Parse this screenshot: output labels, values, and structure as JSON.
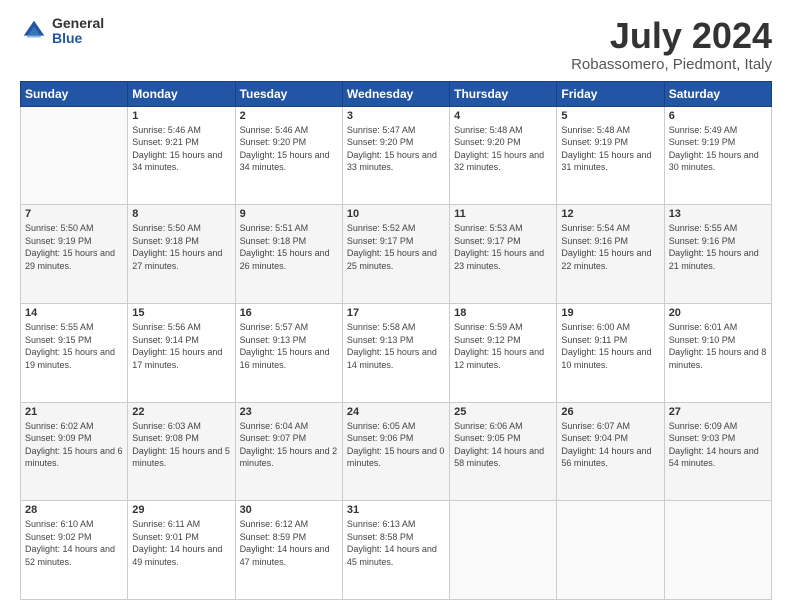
{
  "logo": {
    "general": "General",
    "blue": "Blue"
  },
  "title": "July 2024",
  "subtitle": "Robassomero, Piedmont, Italy",
  "days_of_week": [
    "Sunday",
    "Monday",
    "Tuesday",
    "Wednesday",
    "Thursday",
    "Friday",
    "Saturday"
  ],
  "weeks": [
    [
      {
        "day": "",
        "sunrise": "",
        "sunset": "",
        "daylight": ""
      },
      {
        "day": "1",
        "sunrise": "Sunrise: 5:46 AM",
        "sunset": "Sunset: 9:21 PM",
        "daylight": "Daylight: 15 hours and 34 minutes."
      },
      {
        "day": "2",
        "sunrise": "Sunrise: 5:46 AM",
        "sunset": "Sunset: 9:20 PM",
        "daylight": "Daylight: 15 hours and 34 minutes."
      },
      {
        "day": "3",
        "sunrise": "Sunrise: 5:47 AM",
        "sunset": "Sunset: 9:20 PM",
        "daylight": "Daylight: 15 hours and 33 minutes."
      },
      {
        "day": "4",
        "sunrise": "Sunrise: 5:48 AM",
        "sunset": "Sunset: 9:20 PM",
        "daylight": "Daylight: 15 hours and 32 minutes."
      },
      {
        "day": "5",
        "sunrise": "Sunrise: 5:48 AM",
        "sunset": "Sunset: 9:19 PM",
        "daylight": "Daylight: 15 hours and 31 minutes."
      },
      {
        "day": "6",
        "sunrise": "Sunrise: 5:49 AM",
        "sunset": "Sunset: 9:19 PM",
        "daylight": "Daylight: 15 hours and 30 minutes."
      }
    ],
    [
      {
        "day": "7",
        "sunrise": "Sunrise: 5:50 AM",
        "sunset": "Sunset: 9:19 PM",
        "daylight": "Daylight: 15 hours and 29 minutes."
      },
      {
        "day": "8",
        "sunrise": "Sunrise: 5:50 AM",
        "sunset": "Sunset: 9:18 PM",
        "daylight": "Daylight: 15 hours and 27 minutes."
      },
      {
        "day": "9",
        "sunrise": "Sunrise: 5:51 AM",
        "sunset": "Sunset: 9:18 PM",
        "daylight": "Daylight: 15 hours and 26 minutes."
      },
      {
        "day": "10",
        "sunrise": "Sunrise: 5:52 AM",
        "sunset": "Sunset: 9:17 PM",
        "daylight": "Daylight: 15 hours and 25 minutes."
      },
      {
        "day": "11",
        "sunrise": "Sunrise: 5:53 AM",
        "sunset": "Sunset: 9:17 PM",
        "daylight": "Daylight: 15 hours and 23 minutes."
      },
      {
        "day": "12",
        "sunrise": "Sunrise: 5:54 AM",
        "sunset": "Sunset: 9:16 PM",
        "daylight": "Daylight: 15 hours and 22 minutes."
      },
      {
        "day": "13",
        "sunrise": "Sunrise: 5:55 AM",
        "sunset": "Sunset: 9:16 PM",
        "daylight": "Daylight: 15 hours and 21 minutes."
      }
    ],
    [
      {
        "day": "14",
        "sunrise": "Sunrise: 5:55 AM",
        "sunset": "Sunset: 9:15 PM",
        "daylight": "Daylight: 15 hours and 19 minutes."
      },
      {
        "day": "15",
        "sunrise": "Sunrise: 5:56 AM",
        "sunset": "Sunset: 9:14 PM",
        "daylight": "Daylight: 15 hours and 17 minutes."
      },
      {
        "day": "16",
        "sunrise": "Sunrise: 5:57 AM",
        "sunset": "Sunset: 9:13 PM",
        "daylight": "Daylight: 15 hours and 16 minutes."
      },
      {
        "day": "17",
        "sunrise": "Sunrise: 5:58 AM",
        "sunset": "Sunset: 9:13 PM",
        "daylight": "Daylight: 15 hours and 14 minutes."
      },
      {
        "day": "18",
        "sunrise": "Sunrise: 5:59 AM",
        "sunset": "Sunset: 9:12 PM",
        "daylight": "Daylight: 15 hours and 12 minutes."
      },
      {
        "day": "19",
        "sunrise": "Sunrise: 6:00 AM",
        "sunset": "Sunset: 9:11 PM",
        "daylight": "Daylight: 15 hours and 10 minutes."
      },
      {
        "day": "20",
        "sunrise": "Sunrise: 6:01 AM",
        "sunset": "Sunset: 9:10 PM",
        "daylight": "Daylight: 15 hours and 8 minutes."
      }
    ],
    [
      {
        "day": "21",
        "sunrise": "Sunrise: 6:02 AM",
        "sunset": "Sunset: 9:09 PM",
        "daylight": "Daylight: 15 hours and 6 minutes."
      },
      {
        "day": "22",
        "sunrise": "Sunrise: 6:03 AM",
        "sunset": "Sunset: 9:08 PM",
        "daylight": "Daylight: 15 hours and 5 minutes."
      },
      {
        "day": "23",
        "sunrise": "Sunrise: 6:04 AM",
        "sunset": "Sunset: 9:07 PM",
        "daylight": "Daylight: 15 hours and 2 minutes."
      },
      {
        "day": "24",
        "sunrise": "Sunrise: 6:05 AM",
        "sunset": "Sunset: 9:06 PM",
        "daylight": "Daylight: 15 hours and 0 minutes."
      },
      {
        "day": "25",
        "sunrise": "Sunrise: 6:06 AM",
        "sunset": "Sunset: 9:05 PM",
        "daylight": "Daylight: 14 hours and 58 minutes."
      },
      {
        "day": "26",
        "sunrise": "Sunrise: 6:07 AM",
        "sunset": "Sunset: 9:04 PM",
        "daylight": "Daylight: 14 hours and 56 minutes."
      },
      {
        "day": "27",
        "sunrise": "Sunrise: 6:09 AM",
        "sunset": "Sunset: 9:03 PM",
        "daylight": "Daylight: 14 hours and 54 minutes."
      }
    ],
    [
      {
        "day": "28",
        "sunrise": "Sunrise: 6:10 AM",
        "sunset": "Sunset: 9:02 PM",
        "daylight": "Daylight: 14 hours and 52 minutes."
      },
      {
        "day": "29",
        "sunrise": "Sunrise: 6:11 AM",
        "sunset": "Sunset: 9:01 PM",
        "daylight": "Daylight: 14 hours and 49 minutes."
      },
      {
        "day": "30",
        "sunrise": "Sunrise: 6:12 AM",
        "sunset": "Sunset: 8:59 PM",
        "daylight": "Daylight: 14 hours and 47 minutes."
      },
      {
        "day": "31",
        "sunrise": "Sunrise: 6:13 AM",
        "sunset": "Sunset: 8:58 PM",
        "daylight": "Daylight: 14 hours and 45 minutes."
      },
      {
        "day": "",
        "sunrise": "",
        "sunset": "",
        "daylight": ""
      },
      {
        "day": "",
        "sunrise": "",
        "sunset": "",
        "daylight": ""
      },
      {
        "day": "",
        "sunrise": "",
        "sunset": "",
        "daylight": ""
      }
    ]
  ]
}
